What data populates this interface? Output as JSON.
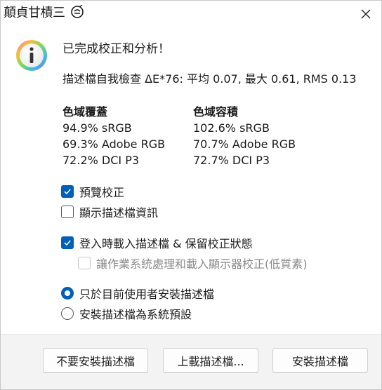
{
  "window": {
    "title": "顛貞甘樍三"
  },
  "message": {
    "heading": "已完成校正和分析！",
    "self_check": "描述檔自我檢查 ΔE*76: 平均 0.07, 最大 0.61, RMS 0.13"
  },
  "gamut_coverage": {
    "title": "色域覆蓋",
    "lines": [
      "94.9% sRGB",
      "69.3% Adobe RGB",
      "72.2% DCI P3"
    ]
  },
  "gamut_volume": {
    "title": "色域容積",
    "lines": [
      "102.6% sRGB",
      "70.7% Adobe RGB",
      "72.7% DCI P3"
    ]
  },
  "options": {
    "preview_calibration": {
      "label": "預覽校正",
      "checked": true
    },
    "show_profile_info": {
      "label": "顯示描述檔資訊",
      "checked": false
    },
    "load_on_login": {
      "label": "登入時載入描述檔 & 保留校正狀態",
      "checked": true
    },
    "os_handle_loading": {
      "label": "讓作業系統處理和載入顯示器校正(低質素)",
      "checked": false,
      "disabled": true
    }
  },
  "install_scope": {
    "current_user": {
      "label": "只於目前使用者安裝描述檔",
      "selected": true
    },
    "system_default": {
      "label": "安裝描述檔為系統預設",
      "selected": false
    }
  },
  "buttons": {
    "dont_install": "不要安裝描述檔",
    "upload": "上載描述檔...",
    "install": "安裝描述檔"
  },
  "colors": {
    "accent": "#005fb8",
    "footer_bg": "#f3f3f3"
  }
}
